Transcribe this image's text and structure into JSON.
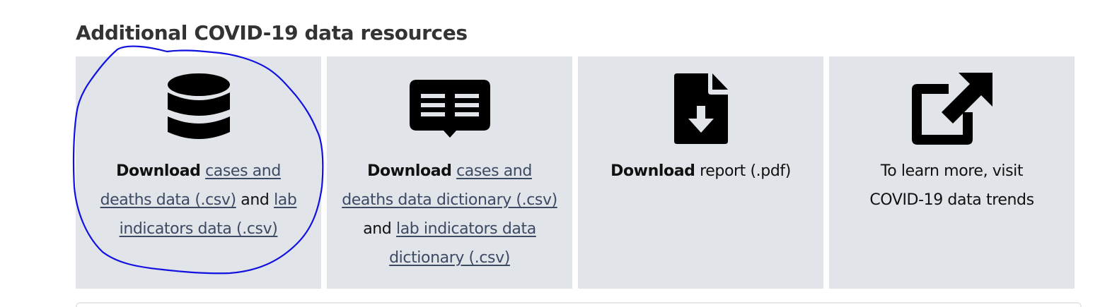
{
  "section": {
    "title": "Additional COVID-19 data resources"
  },
  "cards": [
    {
      "icon": "database-icon",
      "lead": "Download",
      "link1": "cases and deaths data (.csv)",
      "joiner": "and",
      "link2": "lab indicators data (.csv)"
    },
    {
      "icon": "open-book-icon",
      "lead": "Download",
      "link1": "cases and deaths data dictionary (.csv)",
      "joiner": "and",
      "link2": "lab indicators data dictionary (.csv)"
    },
    {
      "icon": "file-download-icon",
      "lead": "Download",
      "link1": "report (.pdf)"
    },
    {
      "icon": "external-link-icon",
      "text": "To learn more, visit",
      "link1": "COVID-19 data trends"
    }
  ],
  "colors": {
    "card_background": "#e1e4e8",
    "link": "#3d4a63",
    "title": "#333333",
    "annotation_stroke": "#1010e0"
  }
}
